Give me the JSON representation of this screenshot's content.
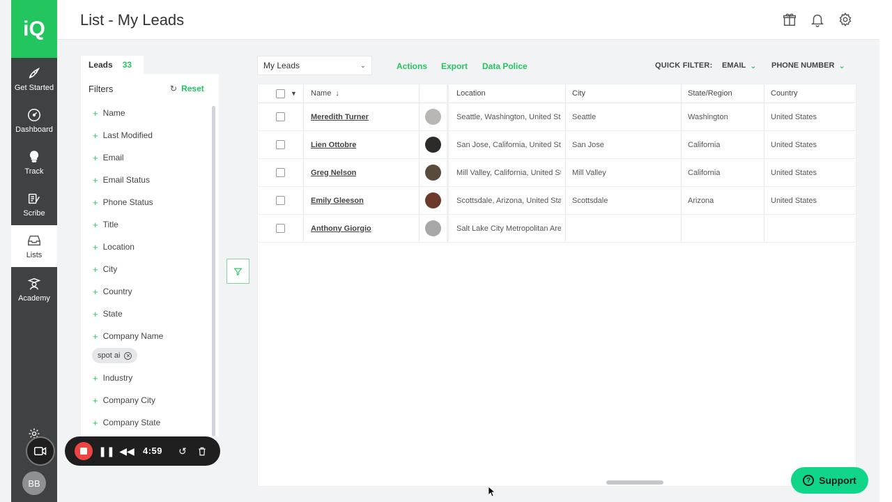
{
  "app": {
    "logo": "iQ",
    "page_title": "List - My Leads"
  },
  "nav": {
    "items": [
      {
        "label": "Get Started",
        "icon": "rocket-icon"
      },
      {
        "label": "Dashboard",
        "icon": "gauge-icon"
      },
      {
        "label": "Track",
        "icon": "lightbulb-icon"
      },
      {
        "label": "Scribe",
        "icon": "scribe-icon"
      },
      {
        "label": "Lists",
        "icon": "inbox-tray-icon",
        "active": true
      },
      {
        "label": "Academy",
        "icon": "graduate-icon"
      }
    ],
    "settings_label": "S",
    "avatar_initials": "BB"
  },
  "header_icons": [
    "gift-icon",
    "bell-icon",
    "gear-icon"
  ],
  "leads_tab": {
    "label": "Leads",
    "count": "33"
  },
  "filters": {
    "title": "Filters",
    "reset": "Reset",
    "items": [
      "Name",
      "Last Modified",
      "Email",
      "Email Status",
      "Phone Status",
      "Title",
      "Location",
      "City",
      "Country",
      "State",
      "Company Name",
      "Industry",
      "Company City",
      "Company State"
    ],
    "active_chip": "spot ai"
  },
  "toolbar": {
    "list_select": "My Leads",
    "actions": "Actions",
    "export": "Export",
    "data_police": "Data Police",
    "quick_filter_label": "QUICK FILTER:",
    "quick_filters": [
      "EMAIL",
      "PHONE NUMBER"
    ]
  },
  "table": {
    "columns": [
      "Name",
      "Location",
      "City",
      "State/Region",
      "Country"
    ],
    "rows": [
      {
        "name": "Meredith Turner",
        "location": "Seattle, Washington, United Sta...",
        "city": "Seattle",
        "state": "Washington",
        "country": "United States",
        "photo": "#b9b6b3"
      },
      {
        "name": "Lien Ottobre",
        "location": "San Jose, California, United Sta...",
        "city": "San Jose",
        "state": "California",
        "country": "United States",
        "photo": "#2e2a28"
      },
      {
        "name": "Greg Nelson",
        "location": "Mill Valley, California, United St...",
        "city": "Mill Valley",
        "state": "California",
        "country": "United States",
        "photo": "#5a4a3c"
      },
      {
        "name": "Emily Gleeson",
        "location": "Scottsdale, Arizona, United Stat...",
        "city": "Scottsdale",
        "state": "Arizona",
        "country": "United States",
        "photo": "#6b3a2a"
      },
      {
        "name": "Anthony Giorgio",
        "location": "Salt Lake City Metropolitan Are...",
        "city": "",
        "state": "",
        "country": "",
        "photo": "#a8a8a8"
      }
    ]
  },
  "recorder": {
    "time": "4:59"
  },
  "support": {
    "label": "Support"
  },
  "colors": {
    "accent": "#22c55e",
    "nav_bg": "#3f4245",
    "record": "#ef4444",
    "support": "#10d68a"
  }
}
